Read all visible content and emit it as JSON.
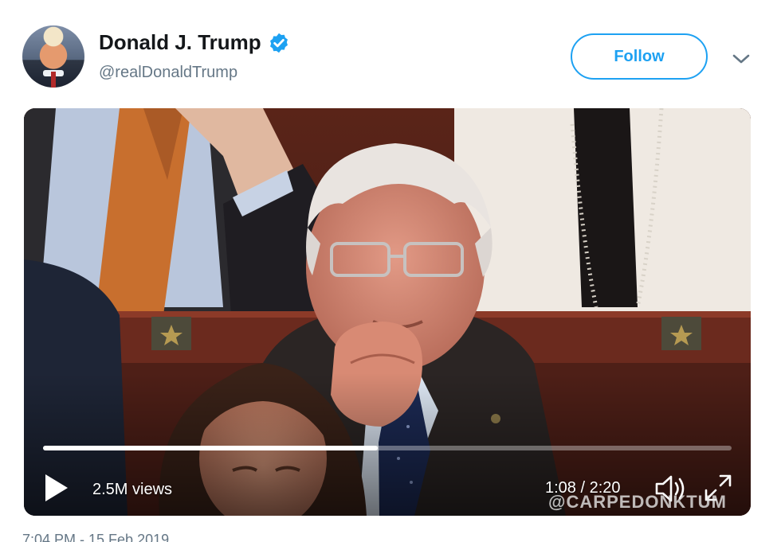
{
  "tweet": {
    "display_name": "Donald J. Trump",
    "handle": "@realDonaldTrump",
    "follow_label": "Follow",
    "timestamp": "7:04 PM - 15 Feb 2019"
  },
  "video": {
    "views": "2.5M views",
    "time": "1:08 / 2:20",
    "progress": 0.486,
    "watermark": "@CARPEDONKTUM"
  },
  "colors": {
    "accent": "#1da1f2",
    "text_primary": "#14171a",
    "text_secondary": "#657786"
  },
  "icons": [
    "verified-badge-icon",
    "chevron-down-icon",
    "play-icon",
    "volume-icon",
    "fullscreen-icon"
  ]
}
